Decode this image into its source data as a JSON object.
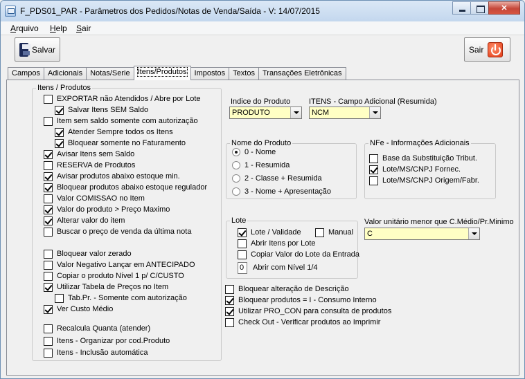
{
  "window": {
    "title": "F_PDS01_PAR - Parâmetros dos Pedidos/Notas de Venda/Saída - V: 14/07/2015"
  },
  "menu": [
    "Arquivo",
    "Help",
    "Sair"
  ],
  "toolbar": {
    "save_label": "Salvar",
    "exit_label": "Sair"
  },
  "tabs": [
    "Campos",
    "Adicionais",
    "Notas/Serie",
    "Itens/Produtos",
    "Impostos",
    "Textos",
    "Transações Eletrônicas"
  ],
  "active_tab": "Itens/Produtos",
  "itens_produtos": {
    "legend": "Itens / Produtos",
    "options": [
      {
        "label": "EXPORTAR não Atendidos / Abre por Lote",
        "checked": false
      },
      {
        "label": "Salvar Itens SEM Saldo",
        "checked": true
      },
      {
        "label": "Item sem saldo somente com autorização",
        "checked": false
      },
      {
        "label": "Atender Sempre todos os Itens",
        "checked": true
      },
      {
        "label": "Bloquear somente no Faturamento",
        "checked": true
      },
      {
        "label": "Avisar Itens sem Saldo",
        "checked": true
      },
      {
        "label": "RESERVA de Produtos",
        "checked": false
      },
      {
        "label": "Avisar produtos abaixo estoque min.",
        "checked": true
      },
      {
        "label": "Bloquear produtos abaixo estoque regulador",
        "checked": true
      },
      {
        "label": "Valor COMISSAO no Item",
        "checked": false
      },
      {
        "label": "Valor do produto > Preço Maximo",
        "checked": true
      },
      {
        "label": "Alterar valor do item",
        "checked": true
      },
      {
        "label": "Buscar o preço de venda da última nota",
        "checked": false
      },
      {
        "label": "Bloquear valor zerado",
        "checked": false
      },
      {
        "label": "Valor Negativo Lançar em ANTECIPADO",
        "checked": false
      },
      {
        "label": "Copiar o produto Nível 1 p/ C/CUSTO",
        "checked": false
      },
      {
        "label": "Utilizar Tabela de Preços no Item",
        "checked": true
      },
      {
        "label": "Tab.Pr. - Somente com autorização",
        "checked": false
      },
      {
        "label": "Ver Custo Médio",
        "checked": true
      },
      {
        "label": "Recalcula Quanta (atender)",
        "checked": false
      },
      {
        "label": "Itens - Organizar por cod.Produto",
        "checked": false
      },
      {
        "label": "Itens - Inclusão automática",
        "checked": false
      }
    ]
  },
  "indice_produto": {
    "label": "Indice do Produto",
    "value": "PRODUTO"
  },
  "itens_campo_adicional": {
    "label": "ITENS - Campo Adicional (Resumida)",
    "value": "NCM"
  },
  "nome_produto": {
    "legend": "Nome do Produto",
    "options": [
      "0 - Nome",
      "1 - Resumida",
      "2 - Classe + Resumida",
      "3 - Nome + Apresentação"
    ],
    "selected": "0 - Nome"
  },
  "nfe": {
    "legend": "NFe - Informações Adicionais",
    "options": [
      {
        "label": "Base da Substituição Tribut.",
        "checked": false
      },
      {
        "label": "Lote/MS/CNPJ Fornec.",
        "checked": true
      },
      {
        "label": "Lote/MS/CNPJ Origem/Fabr.",
        "checked": false
      }
    ]
  },
  "lote": {
    "legend": "Lote",
    "lote_validade": {
      "label": "Lote / Validade",
      "checked": true
    },
    "manual": {
      "label": "Manual",
      "checked": false
    },
    "abrir_itens": {
      "label": "Abrir Itens por Lote",
      "checked": false
    },
    "copiar_valor": {
      "label": "Copiar Valor do Lote da Entrada",
      "checked": false
    },
    "nivel_value": "0",
    "nivel_label": "Abrir com Nível 1/4"
  },
  "valor_unitario": {
    "label": "Valor unitário menor que C.Médio/Pr.Minimo",
    "value": "C"
  },
  "bottom_options": [
    {
      "label": "Bloquear alteração de Descrição",
      "checked": false
    },
    {
      "label": "Bloquear produtos = I - Consumo Interno",
      "checked": true
    },
    {
      "label": "Utilizar PRO_CON para consulta de produtos",
      "checked": true
    },
    {
      "label": "Check Out - Verificar produtos ao Imprimir",
      "checked": false
    }
  ],
  "colors": {
    "combo_background": "#ffffc4",
    "close_button": "#c6473a"
  }
}
